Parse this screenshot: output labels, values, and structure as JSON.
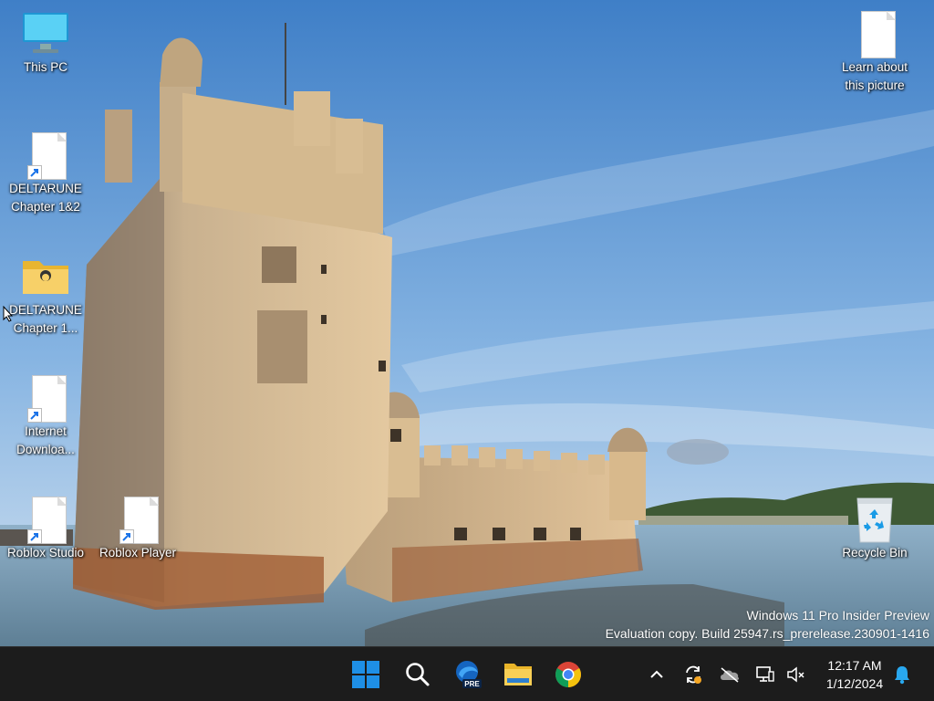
{
  "desktop": {
    "icons": [
      {
        "name": "This PC",
        "type": "computer",
        "label": "This PC"
      },
      {
        "name": "DELTARUNE Chapter 1&2 shortcut",
        "type": "shortcut",
        "label": "DELTARUNE\nChapter 1&2"
      },
      {
        "name": "DELTARUNE Chapter 1 folder",
        "type": "folder",
        "label": "DELTARUNE\nChapter 1..."
      },
      {
        "name": "Internet Download shortcut",
        "type": "shortcut",
        "label": "Internet\nDownloa..."
      },
      {
        "name": "Roblox Studio",
        "type": "shortcut",
        "label": "Roblox Studio"
      },
      {
        "name": "Roblox Player",
        "type": "shortcut",
        "label": "Roblox Player"
      },
      {
        "name": "Learn about this picture",
        "type": "document",
        "label": "Learn about\nthis picture"
      },
      {
        "name": "Recycle Bin",
        "type": "recycle-bin",
        "label": "Recycle Bin"
      }
    ]
  },
  "watermark": {
    "line1": "Windows 11 Pro Insider Preview",
    "line2": "Evaluation copy. Build 25947.rs_prerelease.230901-1416"
  },
  "taskbar": {
    "apps": [
      {
        "name": "Start",
        "icon": "windows-logo-icon"
      },
      {
        "name": "Search",
        "icon": "search-icon"
      },
      {
        "name": "Microsoft Edge Preview",
        "icon": "edge-pre-icon",
        "badge": "PRE"
      },
      {
        "name": "File Explorer",
        "icon": "folder-icon"
      },
      {
        "name": "Google Chrome",
        "icon": "chrome-icon"
      }
    ],
    "tray": [
      {
        "name": "Show hidden icons",
        "icon": "chevron-up-icon"
      },
      {
        "name": "Sync status",
        "icon": "sync-icon"
      },
      {
        "name": "OneDrive",
        "icon": "onedrive-icon"
      },
      {
        "name": "Network",
        "icon": "network-icon"
      },
      {
        "name": "Volume muted",
        "icon": "volume-muted-icon"
      }
    ],
    "clock": {
      "time": "12:17 AM",
      "date": "1/12/2024"
    },
    "notifications_icon": "bell-icon"
  },
  "colors": {
    "taskbar_bg": "#1c1c1c",
    "accent_blue": "#0078d4",
    "folder_yellow": "#f2c744",
    "sky_top": "#4f8fd1",
    "sky_bottom": "#bcd6ef"
  }
}
